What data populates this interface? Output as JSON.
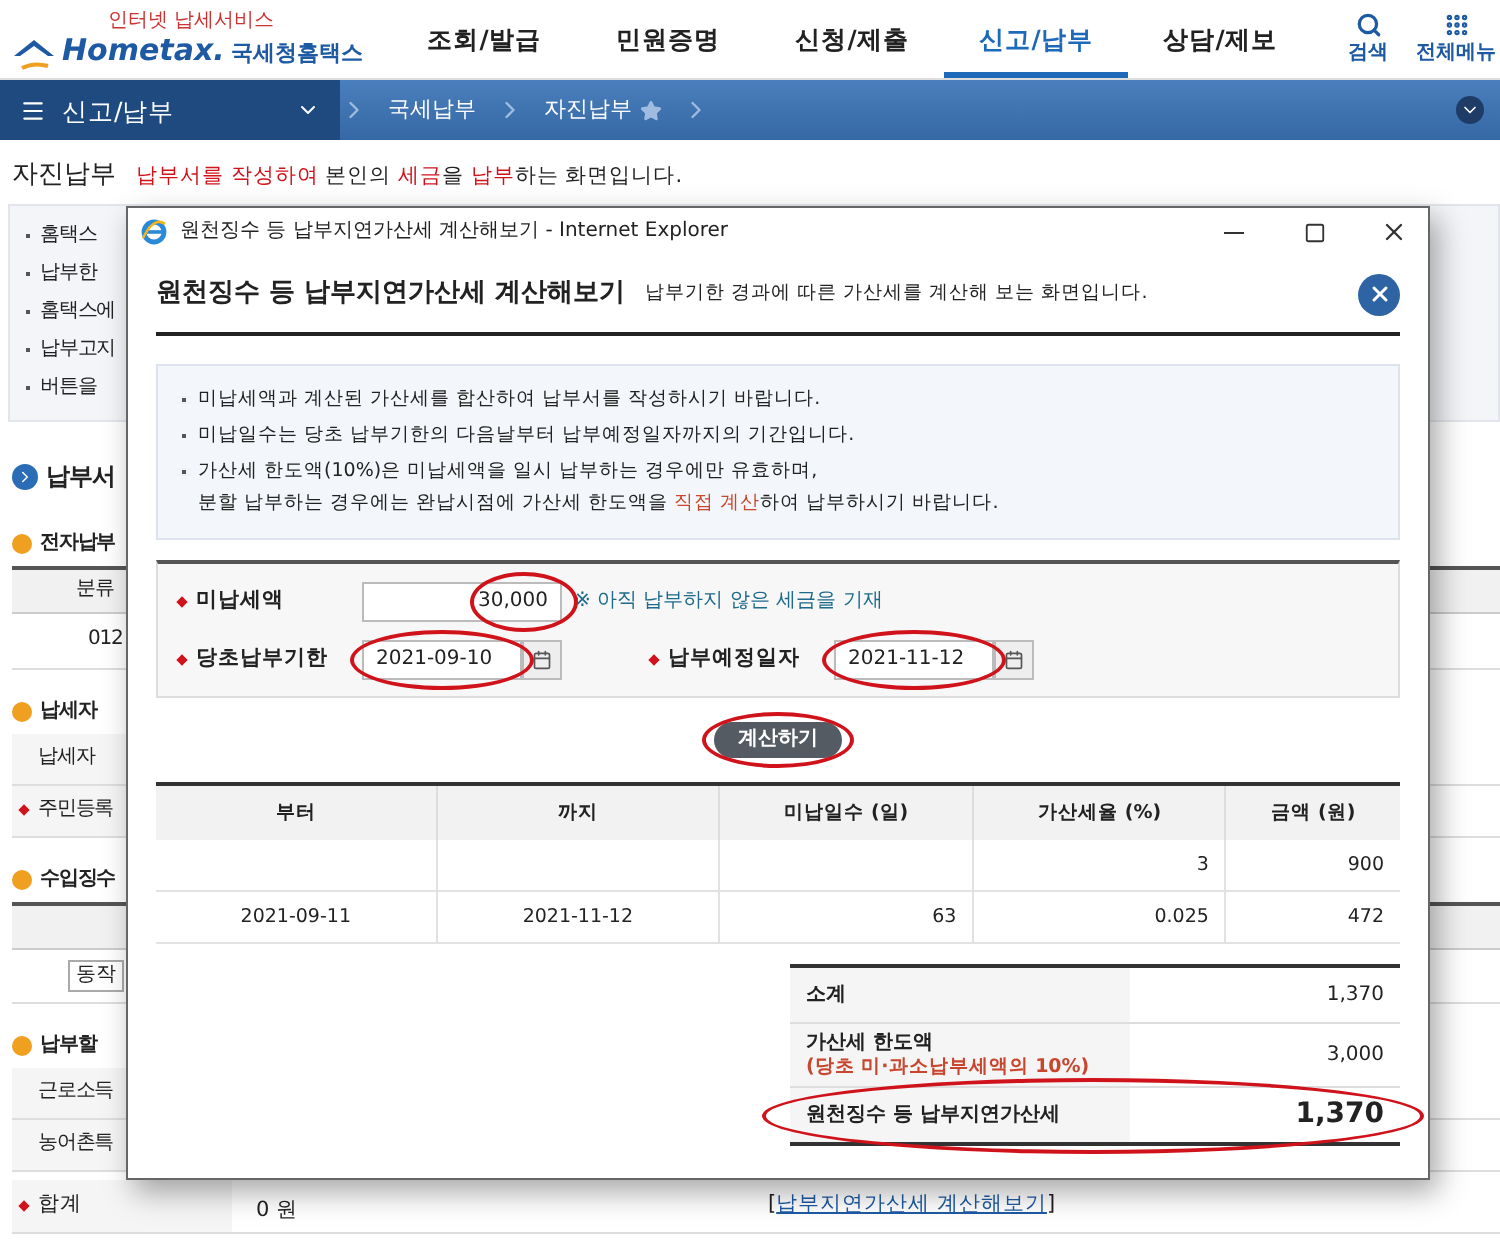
{
  "header": {
    "tagline": "인터넷 납세서비스",
    "logo": "Hometax.",
    "logo_sub": "국세청홈택스",
    "nav": [
      {
        "label": "조회/발급",
        "selected": false
      },
      {
        "label": "민원증명",
        "selected": false
      },
      {
        "label": "신청/제출",
        "selected": false
      },
      {
        "label": "신고/납부",
        "selected": true
      },
      {
        "label": "상담/제보",
        "selected": false
      }
    ],
    "tools": [
      {
        "kind": "search",
        "label": "검색"
      },
      {
        "kind": "menu",
        "label": "전체메뉴"
      }
    ]
  },
  "menu_bar": {
    "section": "신고/납부",
    "breadcrumbs": [
      {
        "label": "국세납부",
        "kind": "plain"
      },
      {
        "label": "자진납부",
        "kind": "favorite"
      }
    ]
  },
  "page": {
    "title": "자진납부",
    "description": "**납부서를 작성하여** 본인의 **세금**을 **납부**하는 화면입니다.",
    "notices": [
      "홈택스",
      "납부한",
      "홈택스에",
      "납부고지",
      "버튼을"
    ],
    "rows": [
      {
        "kind": "title",
        "text": "납부서"
      },
      {
        "kind": "subtitle",
        "text": "전자납부"
      },
      {
        "kind": "header",
        "text": "분류"
      },
      {
        "kind": "cell",
        "text": "012"
      },
      {
        "kind": "subtitle",
        "text": "납세자"
      },
      {
        "kind": "label",
        "text": "납세자",
        "required": false
      },
      {
        "kind": "label",
        "text": "주민등록",
        "required": true
      },
      {
        "kind": "subtitle",
        "text": "수입징수"
      },
      {
        "kind": "header"
      },
      {
        "kind": "select",
        "text": "동작"
      },
      {
        "kind": "subtitle",
        "text": "납부할"
      },
      {
        "kind": "label",
        "text": "근로소득",
        "required": false
      },
      {
        "kind": "label",
        "text": "농어촌특",
        "required": false
      }
    ],
    "total": {
      "label": "합계",
      "required": true,
      "value": "0 원",
      "link_prefix": "[",
      "link": "납부지연가산세 계산해보기",
      "link_suffix": "]"
    }
  },
  "popup": {
    "window_title": "원천징수 등 납부지연가산세 계산해보기 - Internet Explorer",
    "title": "원천징수 등 납부지연가산세 계산해보기",
    "subtitle": "납부기한 경과에 따른 가산세를 계산해 보는 화면입니다.",
    "notices": [
      "미납세액과 계산된 가산세를 합산하여 납부서를 작성하시기 바랍니다.",
      "미납일수는 당초 납부기한의 다음날부터 납부예정일자까지의 기간입니다.",
      "가산세 한도액(10%)은 미납세액을 일시 납부하는 경우에만 유효하며,\n분할 납부하는 경우에는 완납시점에 가산세 한도액을 **직접 계산**하여 납부하시기 바랍니다."
    ],
    "amount": {
      "label": "미납세액",
      "required": true,
      "value": "30,000",
      "circled": true,
      "hint": "※ 아직 납부하지 않은 세금을 기재"
    },
    "dates": [
      {
        "label": "당초납부기한",
        "required": true,
        "value": "2021-09-10",
        "circled": true
      },
      {
        "label": "납부예정일자",
        "required": true,
        "value": "2021-11-12",
        "circled": true
      }
    ],
    "button": {
      "label": "계산하기",
      "circled": true
    },
    "table": {
      "columns": [
        "부터",
        "까지",
        "미납일수 (일)",
        "가산세율 (%)",
        "금액 (원)"
      ],
      "rows": [
        [
          null,
          null,
          null,
          "3",
          "900"
        ],
        [
          "2021-09-11",
          "2021-11-12",
          "63",
          "0.025",
          "472"
        ]
      ]
    },
    "summary": [
      {
        "kind": "normal",
        "label": "소계",
        "value": "1,370",
        "circled": false
      },
      {
        "kind": "normal",
        "label": "가산세 한도액",
        "note": "(당초 미·과소납부세액의 10%)",
        "value": "3,000",
        "circled": false
      },
      {
        "kind": "total",
        "label": "원천징수 등 납부지연가산세",
        "value": "1,370",
        "circled": true
      }
    ]
  }
}
